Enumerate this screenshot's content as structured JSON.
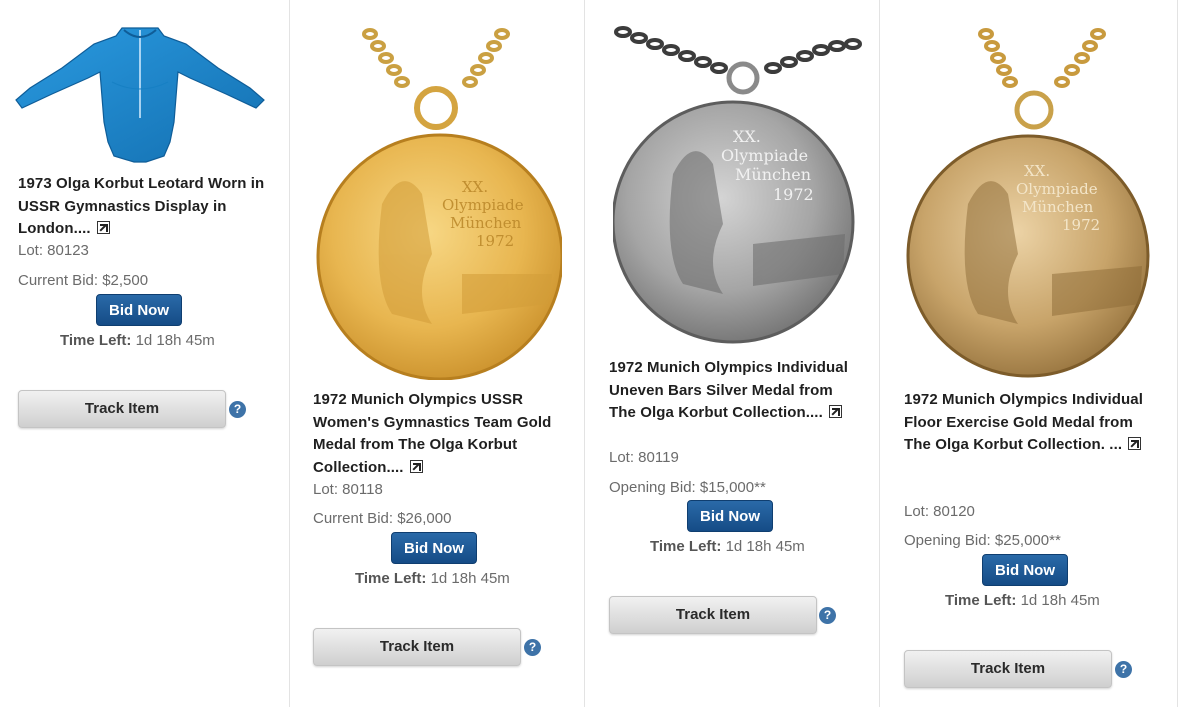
{
  "items": [
    {
      "title": "1973 Olga Korbut Leotard Worn in USSR Gymnastics Display in London....",
      "lot": "Lot: 80123",
      "bid": "Current Bid: $2,500",
      "bid_button": "Bid Now",
      "time_left_label": "Time Left:",
      "time_left_value": "1d 18h 45m",
      "track_button": "Track Item",
      "help": "?"
    },
    {
      "title": "1972 Munich Olympics USSR Women's Gymnastics Team Gold Medal from The Olga Korbut Collection....",
      "lot": "Lot: 80118",
      "bid": "Current Bid: $26,000",
      "bid_button": "Bid Now",
      "time_left_label": "Time Left:",
      "time_left_value": "1d 18h 45m",
      "track_button": "Track Item",
      "help": "?"
    },
    {
      "title": "1972 Munich Olympics Individual Uneven Bars Silver Medal from The Olga Korbut Collection....",
      "lot": "Lot: 80119",
      "bid": "Opening Bid: $15,000**",
      "bid_button": "Bid Now",
      "time_left_label": "Time Left:",
      "time_left_value": "1d 18h 45m",
      "track_button": "Track Item",
      "help": "?"
    },
    {
      "title": "1972 Munich Olympics Individual Floor Exercise Gold Medal from The Olga Korbut Collection. ...",
      "lot": "Lot: 80120",
      "bid": "Opening Bid: $25,000**",
      "bid_button": "Bid Now",
      "time_left_label": "Time Left:",
      "time_left_value": "1d 18h 45m",
      "track_button": "Track Item",
      "help": "?"
    }
  ],
  "medals": {
    "medal2": {
      "line1": "XX.",
      "line2": "Olympiade",
      "line3": "München",
      "line4": "1972"
    },
    "medal3": {
      "line1": "XX.",
      "line2": "Olympiade",
      "line3": "München",
      "line4": "1972"
    },
    "medal4": {
      "line1": "XX.",
      "line2": "Olympiade",
      "line3": "München",
      "line4": "1972"
    }
  },
  "colors": {
    "leotard": "#1e8ad0",
    "gold_medal": "#e7b64a",
    "silver_medal": "#9c9c9c",
    "antique_gold_medal": "#c9a66b",
    "bid_button": "#1b5994",
    "help_icon": "#3e73a8"
  }
}
